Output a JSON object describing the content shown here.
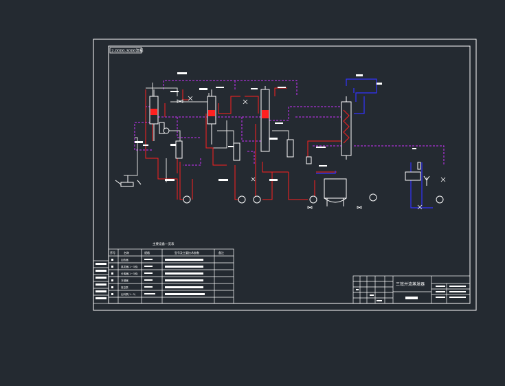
{
  "drawing": {
    "frame_tag": "2-0000-3000流程",
    "title_block": {
      "name": "三效并流蒸发器",
      "cells_right": [
        "",
        "",
        "",
        ""
      ]
    },
    "equipment_table": {
      "title": "主要设备一览表",
      "headers": [
        "序号",
        "名称",
        "规格",
        "型号及主要技术参数",
        "备注"
      ],
      "rows": [
        {
          "no": "1",
          "name": "加热器",
          "spec": ""
        },
        {
          "no": "2",
          "name": "蒸发器(1~3效)",
          "spec": ""
        },
        {
          "no": "3",
          "name": "分离器(1~3效)",
          "spec": ""
        },
        {
          "no": "4",
          "name": "冷凝器",
          "spec": ""
        },
        {
          "no": "5",
          "name": "真空泵",
          "spec": ""
        },
        {
          "no": "6",
          "name": "出料泵(1~3)",
          "spec": ""
        }
      ]
    },
    "colors": {
      "background": "#242a31",
      "frame": "#ffffff",
      "steam_line": "#e0e0e0",
      "vapor_line_dashed": "#cc33ff",
      "condensate_line": "#ff2020",
      "cooling_water_line": "#3333ff",
      "label_box": "#ffffff"
    }
  }
}
